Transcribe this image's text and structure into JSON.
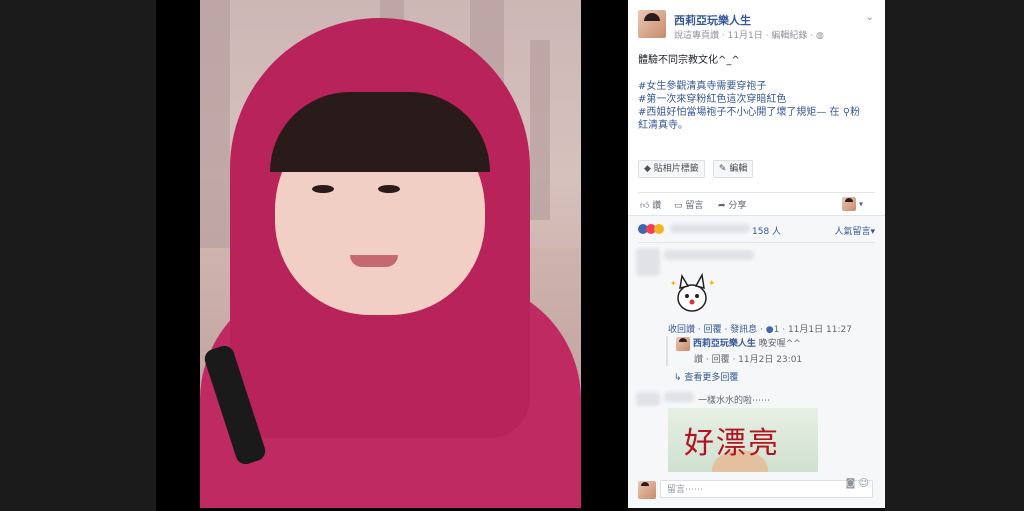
{
  "post": {
    "page_name": "西莉亞玩樂人生",
    "meta_prefix": "說這專頁讚 ·",
    "date": "11月1日",
    "edit_history": "編輯紀錄",
    "privacy_icon": "globe-icon",
    "menu_icon": "chevron-down-icon",
    "text_lines": [
      "體驗不同宗教文化^_^",
      "",
      "#女生參觀清真寺需要穿袍子",
      "#第一次來穿粉紅色這次穿暗紅色",
      "#西姐好怕當場袍子不小心開了壞了規矩— 在",
      "紅清真寺。"
    ],
    "location_tail": "粉",
    "tag_photo_button": "貼相片標籤",
    "edit_button": "編輯"
  },
  "actions": {
    "like": "讚",
    "comment": "留言",
    "share": "分享"
  },
  "reactions": {
    "count": "158 人",
    "sort": "人氣留言"
  },
  "comments": {
    "c1_actions": "收回讚 · 回覆 · 發訊息 ·",
    "c1_likes": "1",
    "c1_time": "· 11月1日 11:27",
    "reply_name": "西莉亞玩樂人生",
    "reply_text": "晚安喔^^",
    "reply_meta": "讚 · 回覆 · 11月2日 23:01",
    "more_replies": "查看更多回覆",
    "c2_text": "一樣水水的啦⋯⋯",
    "c2_image_text": "好漂亮",
    "write_placeholder": "留言⋯⋯"
  },
  "colors": {
    "link": "#365899",
    "muted": "#90949c"
  }
}
